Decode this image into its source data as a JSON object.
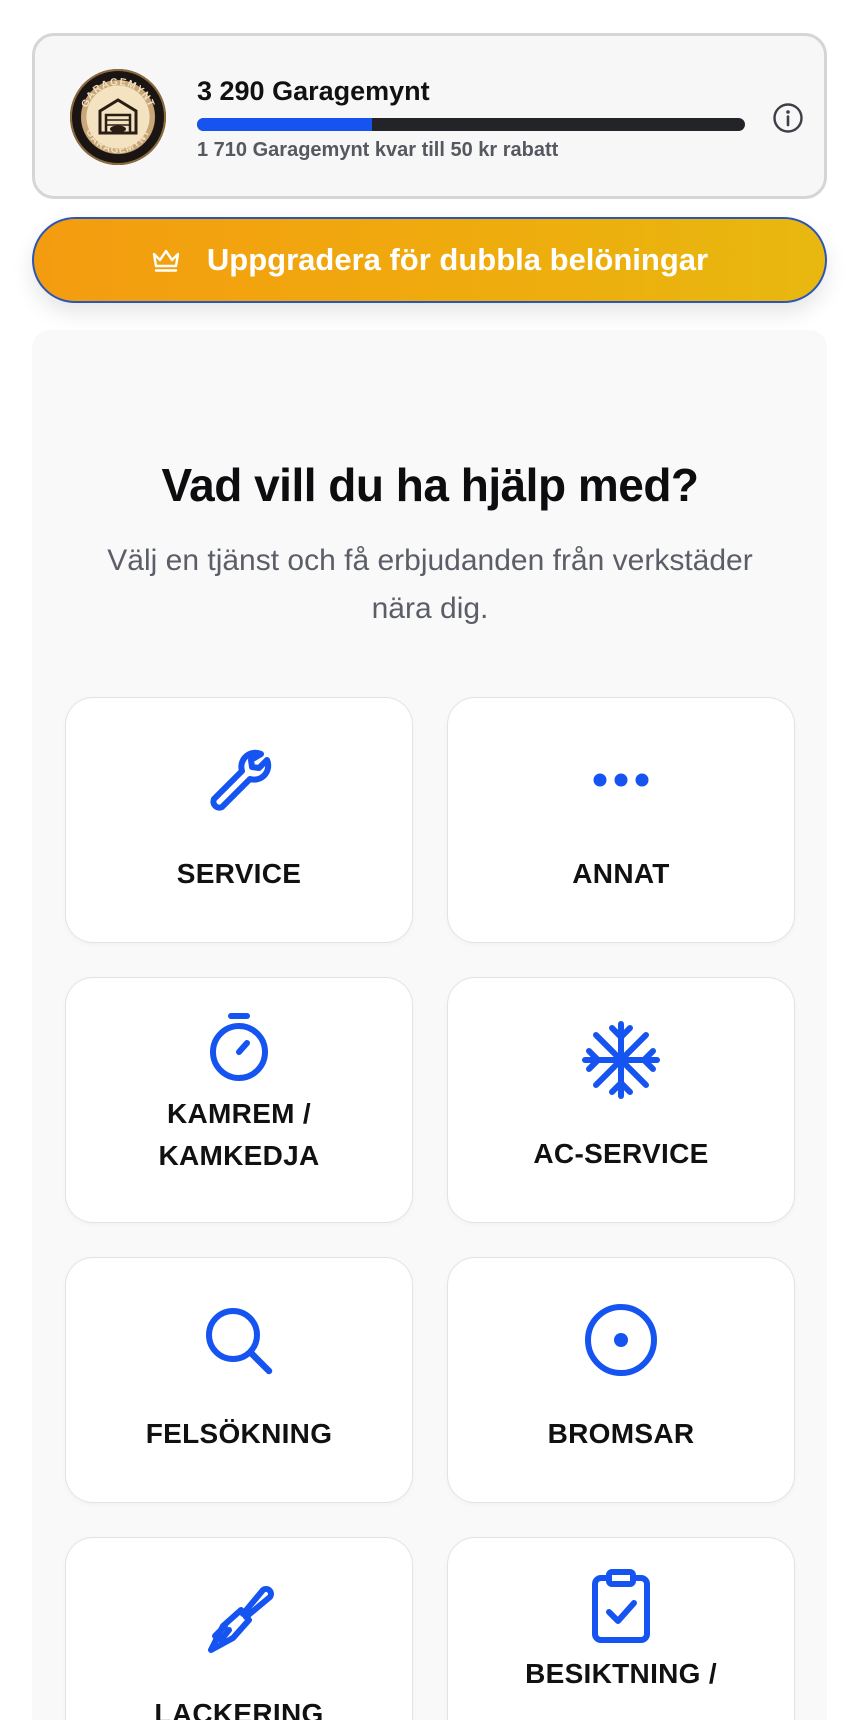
{
  "coins": {
    "title": "3 290 Garagemynt",
    "subtitle": "1 710 Garagemynt kvar till 50 kr rabatt",
    "logo_text": "GARAGEMYNT",
    "progress": 0.32,
    "accent": "#1554f0"
  },
  "upgrade": {
    "label": "Uppgradera för dubbla belöningar",
    "icon": "crown-icon",
    "gradient_start": "#f49c10",
    "gradient_end": "#e8b810"
  },
  "main": {
    "heading": "Vad vill du ha hjälp med?",
    "subheading": "Välj en tjänst och få erbjudanden från verkstäder nära dig.",
    "icon_color": "#1554f0",
    "services": [
      {
        "label": "SERVICE",
        "icon": "wrench-icon"
      },
      {
        "label": "ANNAT",
        "icon": "dots-icon"
      },
      {
        "label_lines": [
          "KAMREM /",
          "KAMKEDJA"
        ],
        "icon": "stopwatch-icon"
      },
      {
        "label": "AC-SERVICE",
        "icon": "snowflake-icon"
      },
      {
        "label": "FELSÖKNING",
        "icon": "magnifier-icon"
      },
      {
        "label": "BROMSAR",
        "icon": "disc-icon"
      },
      {
        "label": "LACKERING",
        "icon": "paintbrush-icon"
      },
      {
        "label": "BESIKTNING /",
        "icon": "clipboard-check-icon"
      }
    ]
  }
}
